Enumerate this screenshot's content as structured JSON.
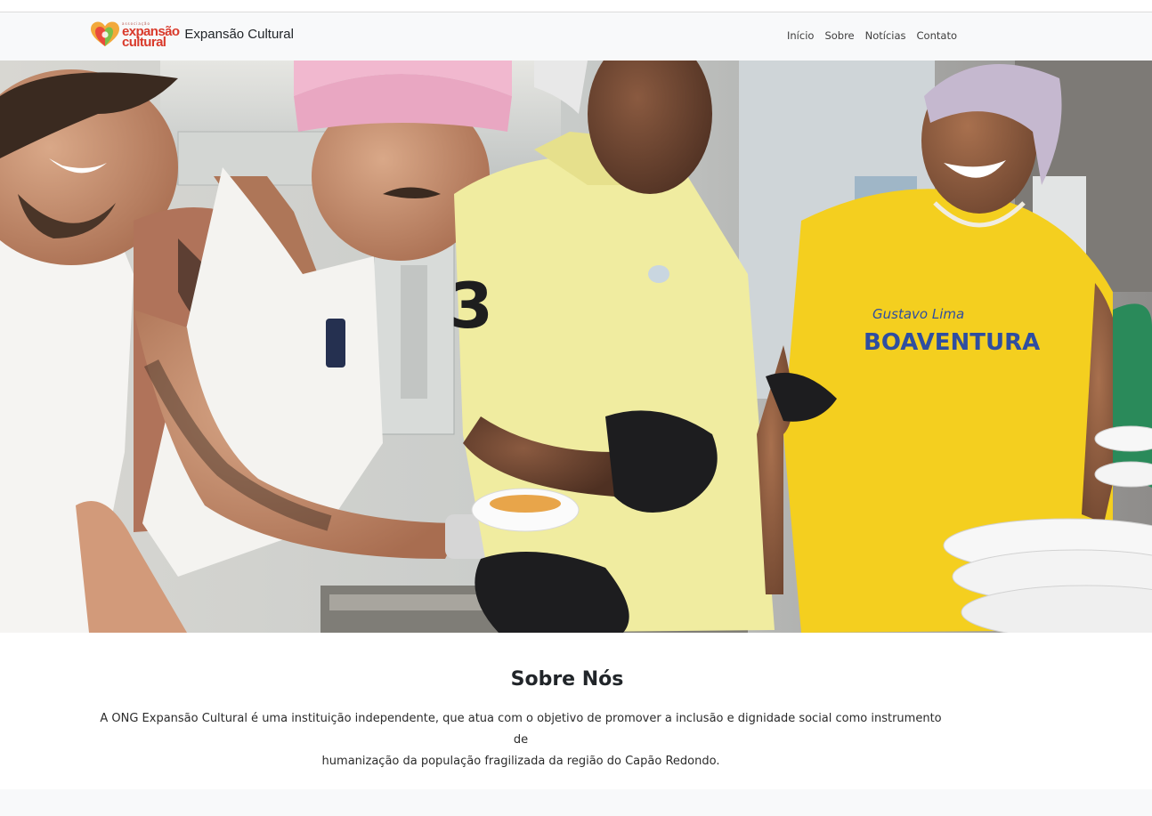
{
  "header": {
    "logo_tiny": "associação",
    "logo_line1": "expansão",
    "logo_line2": "cultural",
    "brand_name": "Expansão Cultural"
  },
  "nav": {
    "items": [
      "Início",
      "Sobre",
      "Notícias",
      "Contato"
    ]
  },
  "hero": {
    "image_alt": "",
    "shirt_text_top": "Gustavo Lima",
    "shirt_text_main": "BOAVENTURA",
    "shirt_number": "3"
  },
  "about": {
    "title": "Sobre Nós",
    "line1": "A ONG Expansão Cultural é uma instituição independente, que atua com o objetivo de promover a inclusão e dignidade social como instrumento de",
    "line2": "humanização da população fragilizada da região do Capão Redondo."
  },
  "colors": {
    "brand_red": "#d93a2b",
    "navbar_bg": "#f8f9fa",
    "text": "#212529"
  }
}
